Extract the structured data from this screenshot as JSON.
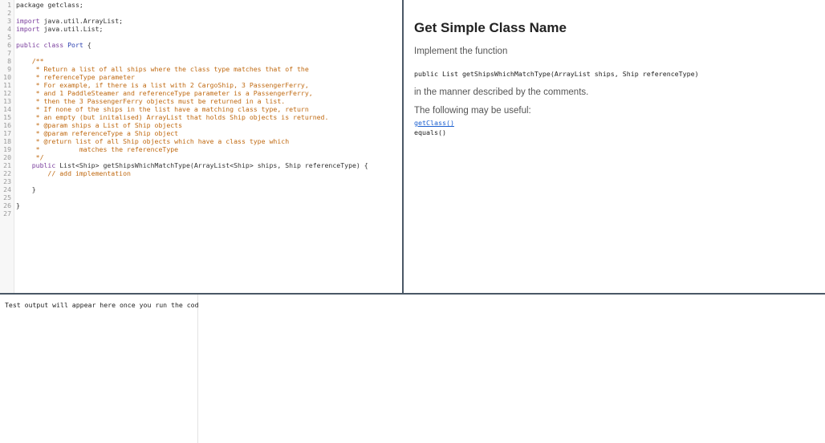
{
  "editor": {
    "lines": [
      {
        "n": "1",
        "segs": [
          {
            "t": "package getclass;",
            "c": "plain"
          }
        ]
      },
      {
        "n": "2",
        "segs": []
      },
      {
        "n": "3",
        "segs": [
          {
            "t": "import",
            "c": "kw"
          },
          {
            "t": " java.util.ArrayList;",
            "c": "plain"
          }
        ]
      },
      {
        "n": "4",
        "segs": [
          {
            "t": "import",
            "c": "kw"
          },
          {
            "t": " java.util.List;",
            "c": "plain"
          }
        ]
      },
      {
        "n": "5",
        "segs": []
      },
      {
        "n": "6",
        "segs": [
          {
            "t": "public class ",
            "c": "kw"
          },
          {
            "t": "Port",
            "c": "cls"
          },
          {
            "t": " {",
            "c": "plain"
          }
        ]
      },
      {
        "n": "7",
        "segs": []
      },
      {
        "n": "8",
        "segs": [
          {
            "t": "    /**",
            "c": "cm"
          }
        ]
      },
      {
        "n": "9",
        "segs": [
          {
            "t": "     * Return a list of all ships where the class type matches that of the",
            "c": "cm"
          }
        ]
      },
      {
        "n": "10",
        "segs": [
          {
            "t": "     * referenceType parameter",
            "c": "cm"
          }
        ]
      },
      {
        "n": "11",
        "segs": [
          {
            "t": "     * For example, if there is a list with 2 CargoShip, 3 PassengerFerry,",
            "c": "cm"
          }
        ]
      },
      {
        "n": "12",
        "segs": [
          {
            "t": "     * and 1 PaddleSteamer and referenceType parameter is a PassengerFerry,",
            "c": "cm"
          }
        ]
      },
      {
        "n": "13",
        "segs": [
          {
            "t": "     * then the 3 PassengerFerry objects must be returned in a list.",
            "c": "cm"
          }
        ]
      },
      {
        "n": "14",
        "segs": [
          {
            "t": "     * If none of the ships in the list have a matching class type, return",
            "c": "cm"
          }
        ]
      },
      {
        "n": "15",
        "segs": [
          {
            "t": "     * an empty (but initalised) ArrayList that holds Ship objects is returned.",
            "c": "cm"
          }
        ]
      },
      {
        "n": "16",
        "segs": [
          {
            "t": "     * @param ships a List of Ship objects",
            "c": "cm"
          }
        ]
      },
      {
        "n": "17",
        "segs": [
          {
            "t": "     * @param referenceType a Ship object",
            "c": "cm"
          }
        ]
      },
      {
        "n": "18",
        "segs": [
          {
            "t": "     * @return list of all Ship objects which have a class type which",
            "c": "cm"
          }
        ]
      },
      {
        "n": "19",
        "segs": [
          {
            "t": "     *          matches the referenceType",
            "c": "cm"
          }
        ]
      },
      {
        "n": "20",
        "segs": [
          {
            "t": "     */",
            "c": "cm"
          }
        ]
      },
      {
        "n": "21",
        "segs": [
          {
            "t": "    public ",
            "c": "kw"
          },
          {
            "t": "List<Ship> getShipsWhichMatchType(ArrayList<Ship> ships, Ship referenceType) {",
            "c": "plain"
          }
        ]
      },
      {
        "n": "22",
        "segs": [
          {
            "t": "        // add implementation",
            "c": "cm"
          }
        ]
      },
      {
        "n": "23",
        "segs": []
      },
      {
        "n": "24",
        "segs": [
          {
            "t": "    }",
            "c": "plain"
          }
        ]
      },
      {
        "n": "25",
        "segs": []
      },
      {
        "n": "26",
        "segs": [
          {
            "t": "}",
            "c": "plain"
          }
        ]
      },
      {
        "n": "27",
        "segs": []
      }
    ]
  },
  "instructions": {
    "title": "Get Simple Class Name",
    "intro": "Implement the function",
    "signature": "public List getShipsWhichMatchType(ArrayList ships, Ship referenceType)",
    "manner": "in the manner described by the comments.",
    "useful": "The following may be useful:",
    "link": "getClass()",
    "equals": "equals()"
  },
  "output": {
    "message": "Test output will appear here once you run the code"
  },
  "colors": {
    "keyword": "#7a3e9d",
    "class_name": "#2a3fb0",
    "comment": "#c06a12",
    "splitter": "#4a5866",
    "link": "#1a5fd0"
  }
}
